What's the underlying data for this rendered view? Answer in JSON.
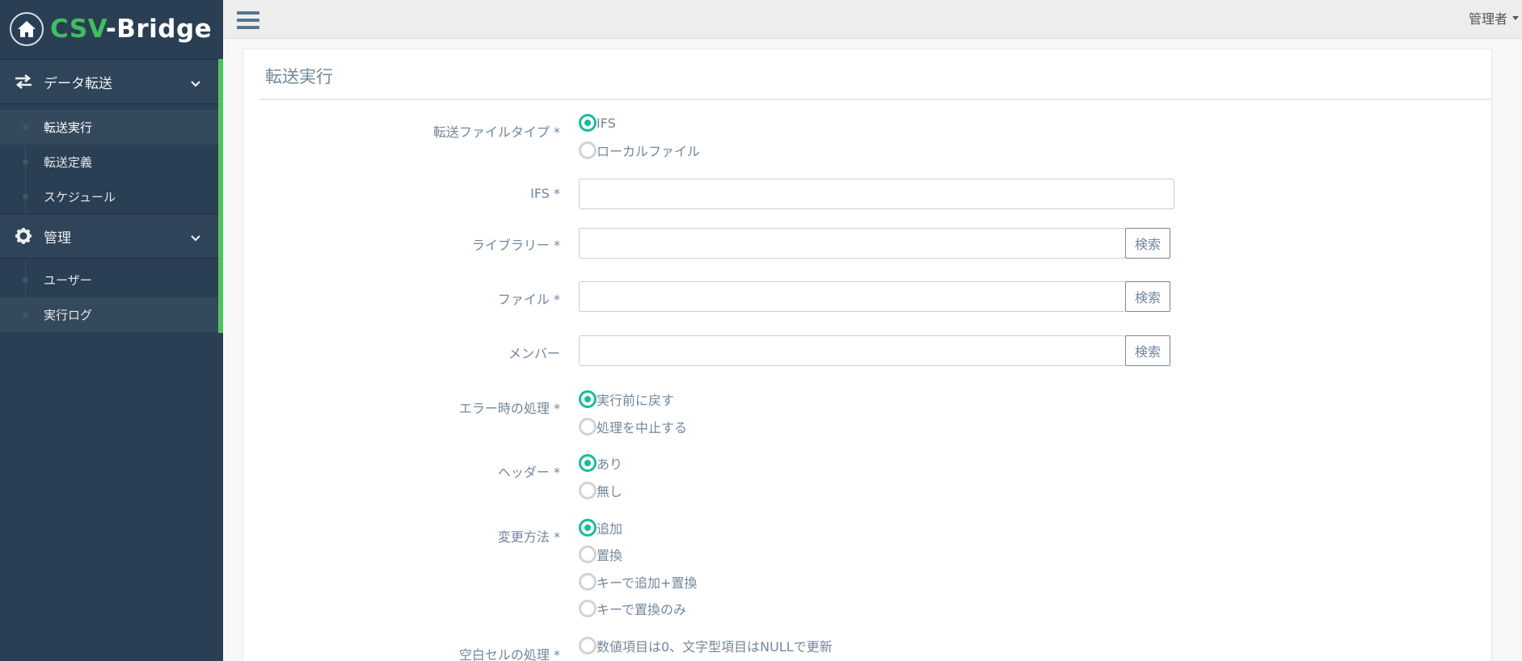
{
  "brand": {
    "csv": "CSV",
    "rest": "-Bridge"
  },
  "sidebar": {
    "groups": [
      {
        "label": "データ転送",
        "items": [
          {
            "label": "転送実行"
          },
          {
            "label": "転送定義"
          },
          {
            "label": "スケジュール"
          }
        ]
      },
      {
        "label": "管理",
        "items": [
          {
            "label": "ユーザー"
          },
          {
            "label": "実行ログ"
          }
        ]
      }
    ]
  },
  "topbar": {
    "user": "管理者"
  },
  "panel": {
    "title": "転送実行"
  },
  "form": {
    "file_type": {
      "label": "転送ファイルタイプ *",
      "options": [
        "IFS",
        "ローカルファイル"
      ],
      "selected": "IFS"
    },
    "ifs": {
      "label": "IFS *",
      "value": ""
    },
    "library": {
      "label": "ライブラリー *",
      "value": "",
      "button": "検索"
    },
    "file": {
      "label": "ファイル *",
      "value": "",
      "button": "検索"
    },
    "member": {
      "label": "メンバー",
      "value": "",
      "button": "検索"
    },
    "error_handling": {
      "label": "エラー時の処理 *",
      "options": [
        "実行前に戻す",
        "処理を中止する"
      ],
      "selected": "実行前に戻す"
    },
    "header": {
      "label": "ヘッダー *",
      "options": [
        "あり",
        "無し"
      ],
      "selected": "あり"
    },
    "change_method": {
      "label": "変更方法 *",
      "options": [
        "追加",
        "置換",
        "キーで追加+置換",
        "キーで置換のみ"
      ],
      "selected": "追加"
    },
    "blank_cell": {
      "label": "空白セルの処理 *",
      "options": [
        "数値項目は0、文字型項目はNULLで更新"
      ],
      "selected": ""
    }
  },
  "colors": {
    "sidebar": "#2a3f54",
    "accent": "#4ec35c",
    "radio": "#1abb9c"
  }
}
